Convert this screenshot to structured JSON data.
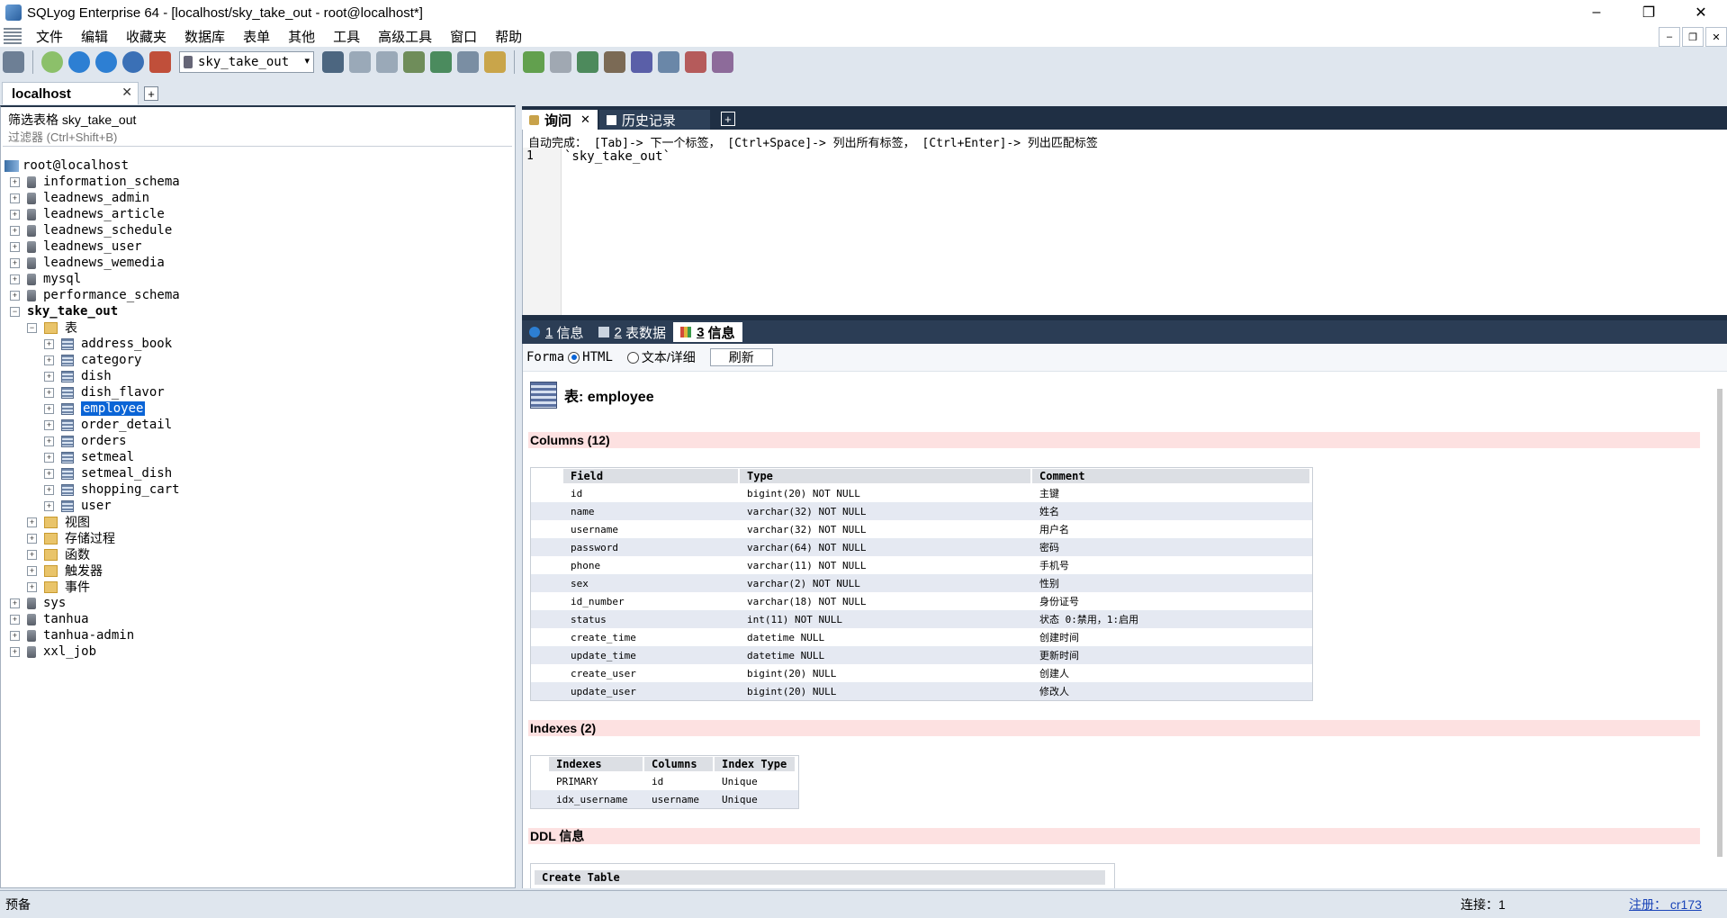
{
  "window": {
    "title": "SQLyog Enterprise 64 - [localhost/sky_take_out - root@localhost*]"
  },
  "menu": [
    "文件",
    "编辑",
    "收藏夹",
    "数据库",
    "表单",
    "其他",
    "工具",
    "高级工具",
    "窗口",
    "帮助"
  ],
  "toolbar": {
    "db_select": "sky_take_out"
  },
  "connection_tab": {
    "label": "localhost"
  },
  "left": {
    "filter_label": "筛选表格 sky_take_out",
    "filter_placeholder": "过滤器 (Ctrl+Shift+B)",
    "root": "root@localhost",
    "databases_before": [
      "information_schema",
      "leadnews_admin",
      "leadnews_article",
      "leadnews_schedule",
      "leadnews_user",
      "leadnews_wemedia",
      "mysql",
      "performance_schema"
    ],
    "current_db": "sky_take_out",
    "tables_folder": "表",
    "tables": [
      "address_book",
      "category",
      "dish",
      "dish_flavor",
      "employee",
      "order_detail",
      "orders",
      "setmeal",
      "setmeal_dish",
      "shopping_cart",
      "user"
    ],
    "selected_table": "employee",
    "folders": [
      "视图",
      "存储过程",
      "函数",
      "触发器",
      "事件"
    ],
    "databases_after": [
      "sys",
      "tanhua",
      "tanhua-admin",
      "xxl_job"
    ]
  },
  "query": {
    "tabs": [
      "询问",
      "历史记录"
    ],
    "autocomplete_hint": "自动完成： [Tab]-> 下一个标签， [Ctrl+Space]-> 列出所有标签， [Ctrl+Enter]-> 列出匹配标签",
    "line_number": "1",
    "sql": "`sky_take_out`"
  },
  "results": {
    "tabs": [
      {
        "num": "1",
        "label": "信息"
      },
      {
        "num": "2",
        "label": "表数据"
      },
      {
        "num": "3",
        "label": "信息"
      }
    ],
    "format_label": "Forma",
    "format_html": "HTML",
    "format_text": "文本/详细",
    "refresh": "刷新",
    "table_title": "表: employee",
    "columns_heading": "Columns (12)",
    "columns_headers": [
      "Field",
      "Type",
      "Comment"
    ],
    "columns": [
      {
        "field": "id",
        "type": "bigint(20) NOT NULL",
        "comment": "主键",
        "key": true
      },
      {
        "field": "name",
        "type": "varchar(32) NOT NULL",
        "comment": "姓名",
        "key": false
      },
      {
        "field": "username",
        "type": "varchar(32) NOT NULL",
        "comment": "用户名",
        "key": false
      },
      {
        "field": "password",
        "type": "varchar(64) NOT NULL",
        "comment": "密码",
        "key": false
      },
      {
        "field": "phone",
        "type": "varchar(11) NOT NULL",
        "comment": "手机号",
        "key": false
      },
      {
        "field": "sex",
        "type": "varchar(2) NOT NULL",
        "comment": "性别",
        "key": false
      },
      {
        "field": "id_number",
        "type": "varchar(18) NOT NULL",
        "comment": "身份证号",
        "key": false
      },
      {
        "field": "status",
        "type": "int(11) NOT NULL",
        "comment": "状态 0:禁用，1:启用",
        "key": false
      },
      {
        "field": "create_time",
        "type": "datetime NULL",
        "comment": "创建时间",
        "key": false
      },
      {
        "field": "update_time",
        "type": "datetime NULL",
        "comment": "更新时间",
        "key": false
      },
      {
        "field": "create_user",
        "type": "bigint(20) NULL",
        "comment": "创建人",
        "key": false
      },
      {
        "field": "update_user",
        "type": "bigint(20) NULL",
        "comment": "修改人",
        "key": false
      }
    ],
    "indexes_heading": "Indexes (2)",
    "indexes_headers": [
      "Indexes",
      "Columns",
      "Index Type"
    ],
    "indexes": [
      {
        "name": "PRIMARY",
        "columns": "id",
        "type": "Unique",
        "key": true
      },
      {
        "name": "idx_username",
        "columns": "username",
        "type": "Unique",
        "key": false
      }
    ],
    "ddl_heading": "DDL 信息",
    "ddl_header": "Create Table"
  },
  "status": {
    "left": "预备",
    "connections": "连接：1",
    "register": "注册： cr173"
  }
}
